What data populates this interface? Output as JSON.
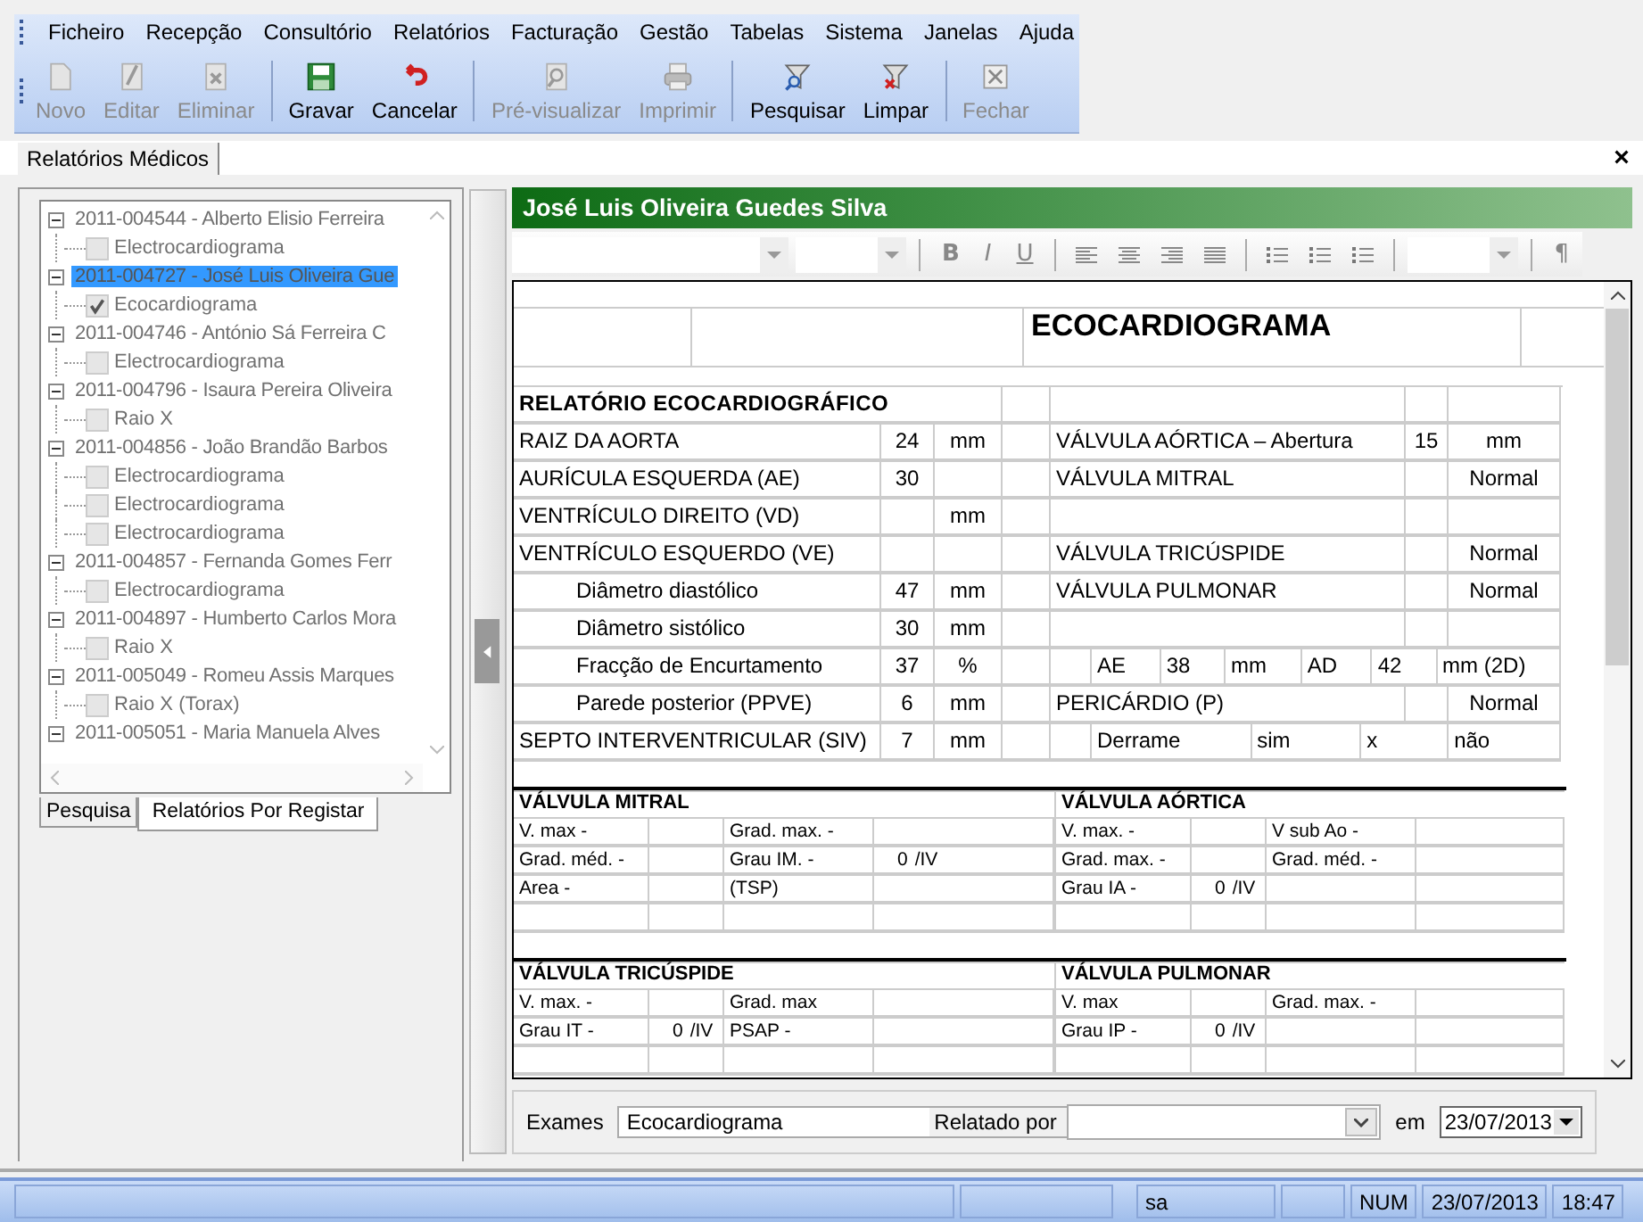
{
  "menu": [
    "Ficheiro",
    "Recepção",
    "Consultório",
    "Relatórios",
    "Facturação",
    "Gestão",
    "Tabelas",
    "Sistema",
    "Janelas",
    "Ajuda"
  ],
  "toolbar": [
    [
      {
        "label": "Novo",
        "kind": "new",
        "disabled": true
      },
      {
        "label": "Editar",
        "kind": "edit",
        "disabled": true
      },
      {
        "label": "Eliminar",
        "kind": "delete",
        "disabled": true
      }
    ],
    [
      {
        "label": "Gravar",
        "kind": "save",
        "disabled": false
      },
      {
        "label": "Cancelar",
        "kind": "undo",
        "disabled": false
      }
    ],
    [
      {
        "label": "Pré-visualizar",
        "kind": "preview",
        "disabled": true
      },
      {
        "label": "Imprimir",
        "kind": "print",
        "disabled": true
      }
    ],
    [
      {
        "label": "Pesquisar",
        "kind": "search",
        "disabled": false
      },
      {
        "label": "Limpar",
        "kind": "clear",
        "disabled": false
      }
    ],
    [
      {
        "label": "Fechar",
        "kind": "close",
        "disabled": true
      }
    ]
  ],
  "doc_tabs": [
    {
      "label": "Relatórios Médicos",
      "selected": true
    }
  ],
  "tree": [
    {
      "label": "2011-004544 - Alberto Elisio Ferreira",
      "selected": false,
      "children": [
        {
          "label": "Electrocardiograma",
          "checked": false
        }
      ]
    },
    {
      "label": "2011-004727 - José Luis Oliveira Gue",
      "selected": true,
      "children": [
        {
          "label": "Ecocardiograma",
          "checked": true
        }
      ]
    },
    {
      "label": "2011-004746 - António Sá Ferreira C",
      "selected": false,
      "children": [
        {
          "label": "Electrocardiograma",
          "checked": false
        }
      ]
    },
    {
      "label": "2011-004796 - Isaura Pereira Oliveira",
      "selected": false,
      "children": [
        {
          "label": "Raio X",
          "checked": false
        }
      ]
    },
    {
      "label": "2011-004856 - João Brandão Barbos",
      "selected": false,
      "children": [
        {
          "label": "Electrocardiograma",
          "checked": false
        },
        {
          "label": "Electrocardiograma",
          "checked": false
        },
        {
          "label": "Electrocardiograma",
          "checked": false
        }
      ]
    },
    {
      "label": "2011-004857 - Fernanda Gomes Ferr",
      "selected": false,
      "children": [
        {
          "label": "Electrocardiograma",
          "checked": false
        }
      ]
    },
    {
      "label": "2011-004897 - Humberto Carlos Mora",
      "selected": false,
      "children": [
        {
          "label": "Raio X",
          "checked": false
        }
      ]
    },
    {
      "label": "2011-005049 - Romeu Assis Marques",
      "selected": false,
      "children": [
        {
          "label": "Raio X (Torax)",
          "checked": false
        }
      ]
    },
    {
      "label": "2011-005051 - Maria Manuela Alves",
      "selected": false
    }
  ],
  "left_tabs": [
    {
      "label": "Pesquisa",
      "selected": false
    },
    {
      "label": "Relatórios Por Registar",
      "selected": true
    }
  ],
  "patient": "José Luis Oliveira Guedes Silva",
  "format_toolbar": {
    "styles": [
      "B",
      "I",
      "U"
    ],
    "pilcrow": "¶"
  },
  "report": {
    "title": "ECOCARDIOGRAMA",
    "heading": "RELATÓRIO ECOCARDIOGRÁFICO",
    "rows": [
      {
        "label": "RAIZ DA AORTA",
        "indent": false,
        "value": "24",
        "unit": "mm",
        "right": {
          "kind": "field",
          "label": "VÁLVULA AÓRTICA – Abertura",
          "value": "15",
          "unit": "mm"
        }
      },
      {
        "label": "AURÍCULA ESQUERDA (AE)",
        "indent": false,
        "value": "30",
        "right": {
          "kind": "field",
          "label": "VÁLVULA MITRAL",
          "unit": "Normal"
        }
      },
      {
        "label": "VENTRÍCULO DIREITO (VD)",
        "indent": false,
        "unit": "mm"
      },
      {
        "label": "VENTRÍCULO ESQUERDO (VE)",
        "indent": false,
        "right": {
          "kind": "field",
          "label": "VÁLVULA TRICÚSPIDE",
          "unit": "Normal"
        }
      },
      {
        "label": "Diâmetro diastólico",
        "indent": true,
        "value": "47",
        "unit": "mm",
        "right": {
          "kind": "field",
          "label": "VÁLVULA PULMONAR",
          "unit": "Normal"
        }
      },
      {
        "label": "Diâmetro sistólico",
        "indent": true,
        "value": "30",
        "unit": "mm"
      },
      {
        "label": "Fracção de Encurtamento",
        "indent": true,
        "value": "37",
        "unit": "%",
        "right": {
          "kind": "cells",
          "cells": [
            "AE",
            "38",
            "mm",
            "AD",
            "42",
            "mm (2D)"
          ]
        }
      },
      {
        "label": "Parede posterior (PPVE)",
        "indent": true,
        "value": "6",
        "unit": "mm",
        "right": {
          "kind": "field",
          "label": "PERICÁRDIO (P)",
          "unit": "Normal"
        }
      },
      {
        "label": "SEPTO INTERVENTRICULAR (SIV)",
        "indent": false,
        "value": "7",
        "unit": "mm",
        "right": {
          "kind": "cells",
          "cells": [
            "Derrame",
            "sim",
            "x",
            "não"
          ]
        }
      }
    ],
    "valves": [
      [
        {
          "title": "VÁLVULA MITRAL",
          "rows": [
            [
              {
                "label": "V. max -"
              },
              {
                "label": "Grad. max. -"
              }
            ],
            [
              {
                "label": "Grad. méd. -"
              },
              {
                "label": "Grau IM. -",
                "value": "0",
                "suffix": "/IV"
              }
            ],
            [
              {
                "label": "Area -"
              },
              {
                "label": "(TSP)"
              }
            ]
          ]
        },
        {
          "title": "VÁLVULA AÓRTICA",
          "rows": [
            [
              {
                "label": "V. max. -"
              },
              {
                "label": "V sub Ao -"
              }
            ],
            [
              {
                "label": "Grad. max. -"
              },
              {
                "label": "Grad. méd. -"
              }
            ],
            [
              {
                "label": "Grau IA -",
                "value": "0",
                "suffix": "/IV"
              }
            ]
          ]
        }
      ],
      [
        {
          "title": "VÁLVULA TRICÚSPIDE",
          "rows": [
            [
              {
                "label": "V. max. -"
              },
              {
                "label": "Grad. max"
              }
            ],
            [
              {
                "label": "Grau IT -",
                "value": "0",
                "suffix": "/IV"
              },
              {
                "label": "PSAP -"
              }
            ]
          ]
        },
        {
          "title": "VÁLVULA PULMONAR",
          "rows": [
            [
              {
                "label": "V. max"
              },
              {
                "label": "Grad. max. -"
              }
            ],
            [
              {
                "label": "Grau IP -",
                "value": "0",
                "suffix": "/IV"
              }
            ]
          ]
        }
      ]
    ]
  },
  "form": {
    "exams_label": "Exames",
    "exams_value": "Ecocardiograma",
    "reported_label": "Relatado por",
    "date_label": "em",
    "date": "23/07/2013"
  },
  "status_bar": {
    "user": "sa",
    "keys": "NUM",
    "date": "23/07/2013",
    "time": "18:47"
  }
}
